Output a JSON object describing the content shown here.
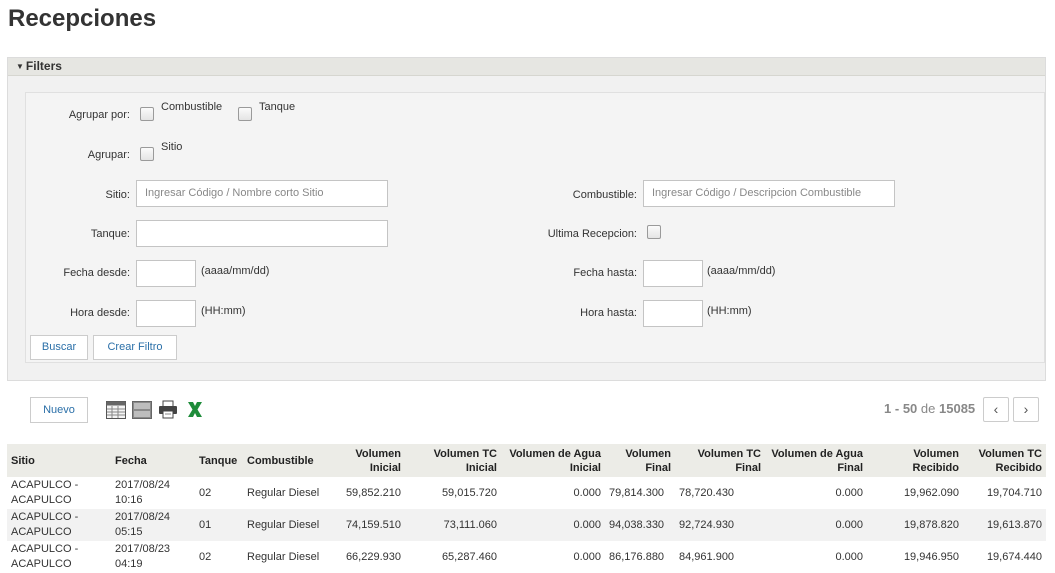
{
  "page": {
    "title": "Recepciones"
  },
  "filters": {
    "header_label": "Filters",
    "agrupar_por_label": "Agrupar por:",
    "combustible_cb_label": "Combustible",
    "tanque_cb_label": "Tanque",
    "agrupar_label": "Agrupar:",
    "sitio_cb_label": "Sitio",
    "sitio_label": "Sitio:",
    "sitio_placeholder": "Ingresar Código / Nombre corto Sitio",
    "combustible_label": "Combustible:",
    "combustible_placeholder": "Ingresar Código / Descripcion Combustible",
    "tanque_label": "Tanque:",
    "ultima_recepcion_label": "Ultima Recepcion:",
    "fecha_desde_label": "Fecha desde:",
    "fecha_hasta_label": "Fecha hasta:",
    "fecha_hint": "(aaaa/mm/dd)",
    "hora_desde_label": "Hora desde:",
    "hora_hasta_label": "Hora hasta:",
    "hora_hint": "(HH:mm)",
    "buscar_label": "Buscar",
    "crear_filtro_label": "Crear Filtro"
  },
  "toolbar": {
    "nuevo_label": "Nuevo",
    "icons": [
      "grid-view-icon",
      "list-view-icon",
      "print-icon",
      "excel-icon"
    ]
  },
  "pager": {
    "start": "1",
    "dash": "-",
    "end": "50",
    "of": "de",
    "total": "15085",
    "prev": "‹",
    "next": "›"
  },
  "table": {
    "headers": [
      "Sitio",
      "Fecha",
      "Tanque",
      "Combustible",
      "Volumen Inicial",
      "Volumen TC Inicial",
      "Volumen de Agua Inicial",
      "Volumen Final",
      "Volumen TC Final",
      "Volumen de Agua Final",
      "Volumen Recibido",
      "Volumen TC Recibido"
    ],
    "rows": [
      [
        "ACAPULCO - ACAPULCO",
        "2017/08/24 10:16",
        "02",
        "Regular Diesel",
        "59,852.210",
        "59,015.720",
        "0.000",
        "79,814.300",
        "78,720.430",
        "0.000",
        "19,962.090",
        "19,704.710"
      ],
      [
        "ACAPULCO - ACAPULCO",
        "2017/08/24 05:15",
        "01",
        "Regular Diesel",
        "74,159.510",
        "73,111.060",
        "0.000",
        "94,038.330",
        "92,724.930",
        "0.000",
        "19,878.820",
        "19,613.870"
      ],
      [
        "ACAPULCO - ACAPULCO",
        "2017/08/23 04:19",
        "02",
        "Regular Diesel",
        "66,229.930",
        "65,287.460",
        "0.000",
        "86,176.880",
        "84,961.900",
        "0.000",
        "19,946.950",
        "19,674.440"
      ]
    ]
  },
  "colors": {
    "link": "#2a6fa8",
    "header_bg": "#ecece7",
    "excel_green": "#1e8c3a"
  }
}
